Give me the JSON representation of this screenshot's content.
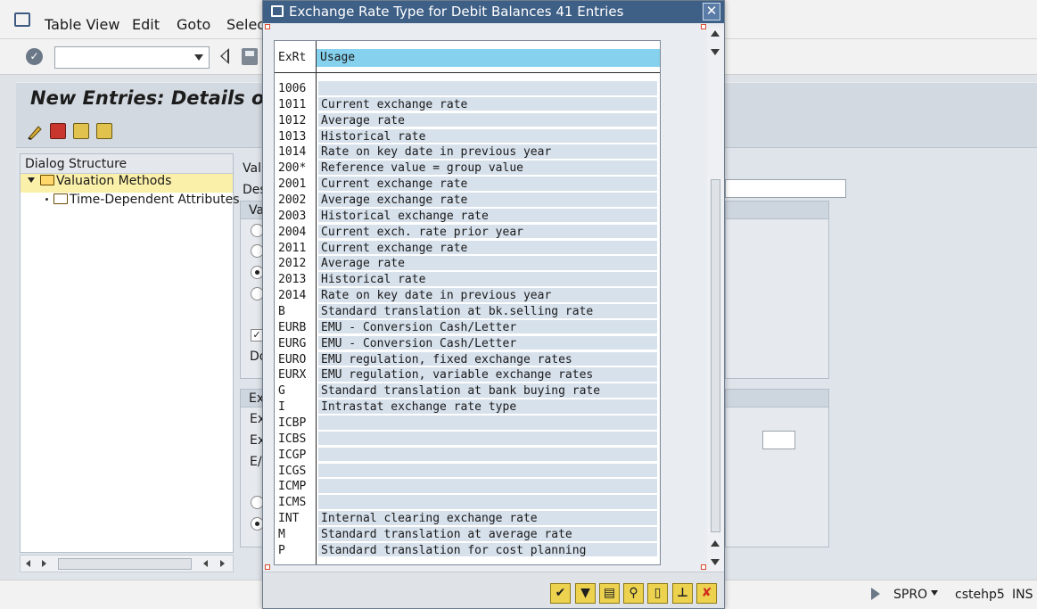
{
  "menu": {
    "items": [
      "Table View",
      "Edit",
      "Goto",
      "Selecti"
    ]
  },
  "toolbar": {
    "command_value": ""
  },
  "page": {
    "title": "New Entries: Details of"
  },
  "dialog_structure": {
    "header": "Dialog Structure",
    "items": [
      {
        "label": "Valuation Methods",
        "selected": true
      },
      {
        "label": "Time-Dependent Attributes",
        "selected": false
      }
    ]
  },
  "detail": {
    "labels": [
      "Valu",
      "Des",
      "Va",
      "Do",
      "Ex",
      "Ex",
      "Ex",
      "E/"
    ]
  },
  "status": {
    "system": "SPRO",
    "server": "cstehp5",
    "mode": "INS"
  },
  "popup": {
    "title": "Exchange Rate Type for Debit Balances 41 Entries",
    "columns": [
      "ExRt",
      "Usage"
    ],
    "rows": [
      {
        "key": "1006",
        "usage": ""
      },
      {
        "key": "1011",
        "usage": "Current exchange rate"
      },
      {
        "key": "1012",
        "usage": "Average rate"
      },
      {
        "key": "1013",
        "usage": "Historical rate"
      },
      {
        "key": "1014",
        "usage": "Rate on key date in previous year"
      },
      {
        "key": "200*",
        "usage": "Reference value = group value"
      },
      {
        "key": "2001",
        "usage": "Current exchange rate"
      },
      {
        "key": "2002",
        "usage": "Average exchange rate"
      },
      {
        "key": "2003",
        "usage": "Historical exchange rate"
      },
      {
        "key": "2004",
        "usage": "Current exch. rate prior year"
      },
      {
        "key": "2011",
        "usage": "Current exchange rate"
      },
      {
        "key": "2012",
        "usage": "Average rate"
      },
      {
        "key": "2013",
        "usage": "Historical rate"
      },
      {
        "key": "2014",
        "usage": "Rate on key date in previous year"
      },
      {
        "key": "B",
        "usage": "Standard translation at bk.selling rate"
      },
      {
        "key": "EURB",
        "usage": "EMU - Conversion Cash/Letter"
      },
      {
        "key": "EURG",
        "usage": "EMU - Conversion Cash/Letter"
      },
      {
        "key": "EURO",
        "usage": "EMU regulation, fixed exchange rates"
      },
      {
        "key": "EURX",
        "usage": "EMU regulation, variable exchange rates"
      },
      {
        "key": "G",
        "usage": "Standard translation at bank buying rate"
      },
      {
        "key": "I",
        "usage": "Intrastat exchange rate type"
      },
      {
        "key": "ICBP",
        "usage": ""
      },
      {
        "key": "ICBS",
        "usage": ""
      },
      {
        "key": "ICGP",
        "usage": ""
      },
      {
        "key": "ICGS",
        "usage": ""
      },
      {
        "key": "ICMP",
        "usage": ""
      },
      {
        "key": "ICMS",
        "usage": ""
      },
      {
        "key": "INT",
        "usage": "Internal clearing exchange rate"
      },
      {
        "key": "M",
        "usage": "Standard translation at average rate"
      },
      {
        "key": "P",
        "usage": "Standard translation for cost planning"
      }
    ],
    "footer_buttons": [
      {
        "name": "continue-button",
        "icon": "checkmark-icon",
        "glyph": "✔"
      },
      {
        "name": "filter-button",
        "icon": "filter-icon",
        "glyph": "▼"
      },
      {
        "name": "print-button",
        "icon": "printer-icon",
        "glyph": "▤"
      },
      {
        "name": "find-button",
        "icon": "binoculars-icon",
        "glyph": "⚲"
      },
      {
        "name": "new-entries-button",
        "icon": "document-icon",
        "glyph": "▯"
      },
      {
        "name": "personal-list-button",
        "icon": "pin-icon",
        "glyph": "⊥"
      },
      {
        "name": "cancel-button",
        "icon": "cross-icon",
        "glyph": "✘"
      }
    ]
  },
  "colors": {
    "popup_title_bg": "#3e5f86",
    "usage_header": "#86d2ee",
    "row_bg": "#d7e1ec",
    "selected_tree": "#fbf0a9",
    "footer_button": "#ecd24f",
    "cancel_red": "#d22d1e"
  }
}
